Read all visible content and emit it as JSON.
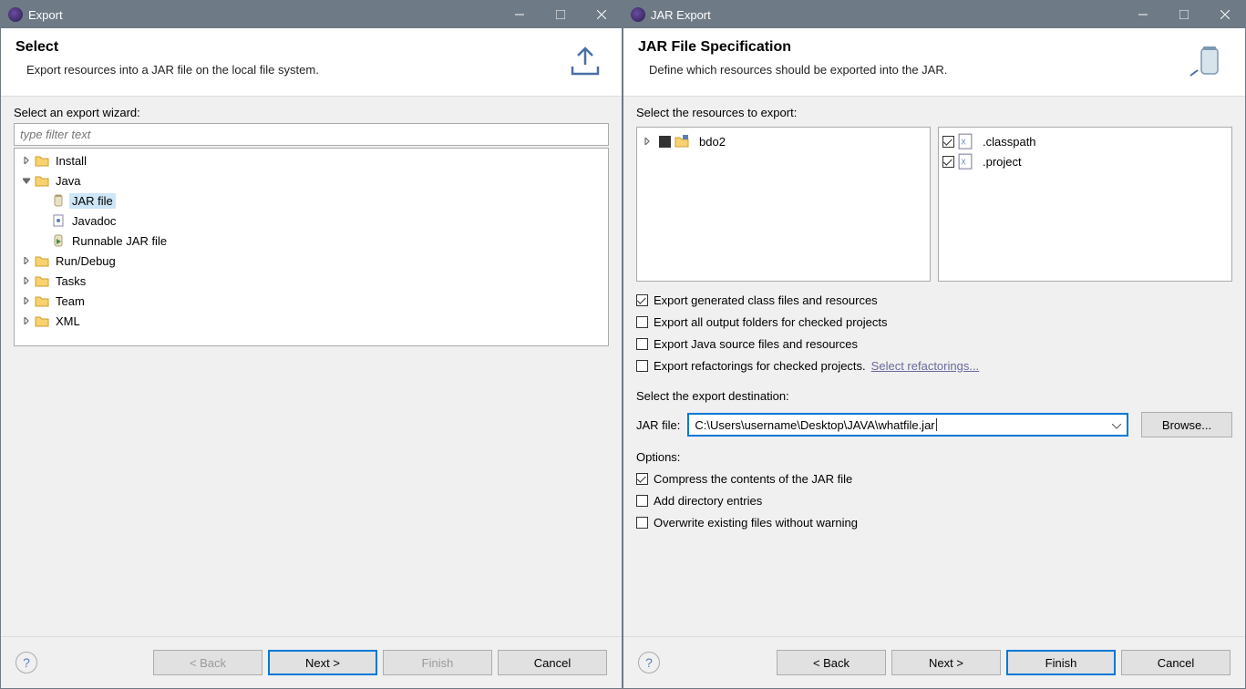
{
  "left": {
    "titlebar": {
      "title": "Export"
    },
    "header": {
      "title": "Select",
      "desc": "Export resources into a JAR file on the local file system."
    },
    "wizard_label": "Select an export wizard:",
    "filter_placeholder": "type filter text",
    "tree": {
      "install": "Install",
      "java": "Java",
      "jar_file": "JAR file",
      "javadoc": "Javadoc",
      "runnable_jar": "Runnable JAR file",
      "run_debug": "Run/Debug",
      "tasks": "Tasks",
      "team": "Team",
      "xml": "XML"
    },
    "footer": {
      "back": "< Back",
      "next": "Next >",
      "finish": "Finish",
      "cancel": "Cancel"
    }
  },
  "right": {
    "titlebar": {
      "title": "JAR Export"
    },
    "header": {
      "title": "JAR File Specification",
      "desc": "Define which resources should be exported into the JAR."
    },
    "resources_label": "Select the resources to export:",
    "project": "bdo2",
    "files": {
      "classpath": ".classpath",
      "project": ".project"
    },
    "opts": {
      "export_generated": "Export generated class files and resources",
      "export_output": "Export all output folders for checked projects",
      "export_source": "Export Java source files and resources",
      "export_refactorings": "Export refactorings for checked projects.",
      "select_refactorings_link": "Select refactorings..."
    },
    "dest_label": "Select the export destination:",
    "jar_label": "JAR file:",
    "jar_path": "C:\\Users\\username\\Desktop\\JAVA\\whatfile.jar",
    "browse": "Browse...",
    "options_label": "Options:",
    "opts2": {
      "compress": "Compress the contents of the JAR file",
      "add_dir": "Add directory entries",
      "overwrite": "Overwrite existing files without warning"
    },
    "footer": {
      "back": "< Back",
      "next": "Next >",
      "finish": "Finish",
      "cancel": "Cancel"
    }
  }
}
